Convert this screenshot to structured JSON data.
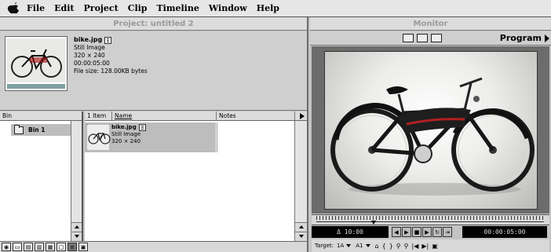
{
  "menubar": {
    "items": [
      "File",
      "Edit",
      "Project",
      "Clip",
      "Timeline",
      "Window",
      "Help"
    ]
  },
  "project": {
    "title": "Project: untitled 2",
    "preview": {
      "name": "bike.jpg",
      "type": "Still Image",
      "dimensions": "320 × 240",
      "duration": "00:00:05:00",
      "file_size": "File size: 128.00KB bytes"
    },
    "bin_header": "Bin",
    "bins": [
      {
        "label": "Bin 1"
      }
    ],
    "list_header": {
      "count": "1 Item",
      "name": "Name",
      "notes": "Notes"
    },
    "clips": [
      {
        "name": "bike.jpg",
        "type": "Still Image",
        "dimensions": "320 × 240"
      }
    ]
  },
  "monitor": {
    "title": "Monitor",
    "view_label": "Program",
    "timecode_left": "Δ 10:00",
    "timecode_right": "00:00:05:00",
    "playhead_fraction": 0.25,
    "target_label": "Target:",
    "video_target": "1A",
    "audio_target": "A1"
  },
  "icons": {
    "apple": "apple-icon",
    "binoculars": "binoculars-icon",
    "folder": "folder-icon",
    "trash": "trash-icon"
  },
  "colors": {
    "menubar_bg": "#e6e6e6",
    "selection": "#bdbdbd",
    "video_bg": "#6c6c6c",
    "timecode_bg": "#000000"
  }
}
